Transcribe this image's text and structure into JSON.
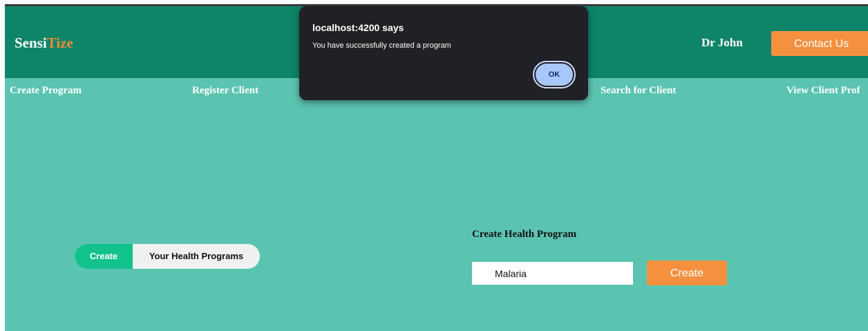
{
  "header": {
    "brand_part1": "Sensi",
    "brand_part2": "Tize",
    "user_name": "Dr John",
    "contact_label": "Contact Us"
  },
  "nav": {
    "items": [
      {
        "label": "Create Program"
      },
      {
        "label": "Register Client"
      },
      {
        "label": "Search for Client"
      },
      {
        "label": "View Client Prof"
      }
    ]
  },
  "toggle": {
    "create_label": "Create",
    "programs_label": "Your Health Programs"
  },
  "form": {
    "title": "Create Health Program",
    "input_value": "Malaria",
    "submit_label": "Create"
  },
  "dialog": {
    "title": "localhost:4200 says",
    "message": "You have successfully created a program",
    "ok_label": "OK"
  },
  "colors": {
    "header_bg": "#0e8469",
    "page_bg": "#5bc4b0",
    "accent_orange": "#f5913e",
    "toggle_active": "#12c28c",
    "dialog_bg": "#202124",
    "dialog_button": "#a8c7fa"
  }
}
